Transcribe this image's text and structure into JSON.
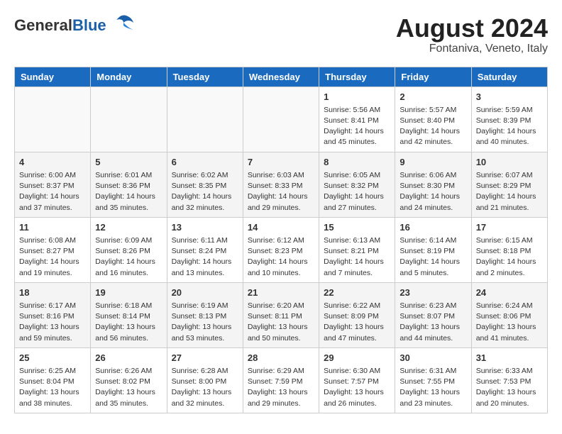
{
  "header": {
    "logo_general": "General",
    "logo_blue": "Blue",
    "month": "August 2024",
    "location": "Fontaniva, Veneto, Italy"
  },
  "days_of_week": [
    "Sunday",
    "Monday",
    "Tuesday",
    "Wednesday",
    "Thursday",
    "Friday",
    "Saturday"
  ],
  "weeks": [
    [
      {
        "day": "",
        "info": ""
      },
      {
        "day": "",
        "info": ""
      },
      {
        "day": "",
        "info": ""
      },
      {
        "day": "",
        "info": ""
      },
      {
        "day": "1",
        "info": "Sunrise: 5:56 AM\nSunset: 8:41 PM\nDaylight: 14 hours\nand 45 minutes."
      },
      {
        "day": "2",
        "info": "Sunrise: 5:57 AM\nSunset: 8:40 PM\nDaylight: 14 hours\nand 42 minutes."
      },
      {
        "day": "3",
        "info": "Sunrise: 5:59 AM\nSunset: 8:39 PM\nDaylight: 14 hours\nand 40 minutes."
      }
    ],
    [
      {
        "day": "4",
        "info": "Sunrise: 6:00 AM\nSunset: 8:37 PM\nDaylight: 14 hours\nand 37 minutes."
      },
      {
        "day": "5",
        "info": "Sunrise: 6:01 AM\nSunset: 8:36 PM\nDaylight: 14 hours\nand 35 minutes."
      },
      {
        "day": "6",
        "info": "Sunrise: 6:02 AM\nSunset: 8:35 PM\nDaylight: 14 hours\nand 32 minutes."
      },
      {
        "day": "7",
        "info": "Sunrise: 6:03 AM\nSunset: 8:33 PM\nDaylight: 14 hours\nand 29 minutes."
      },
      {
        "day": "8",
        "info": "Sunrise: 6:05 AM\nSunset: 8:32 PM\nDaylight: 14 hours\nand 27 minutes."
      },
      {
        "day": "9",
        "info": "Sunrise: 6:06 AM\nSunset: 8:30 PM\nDaylight: 14 hours\nand 24 minutes."
      },
      {
        "day": "10",
        "info": "Sunrise: 6:07 AM\nSunset: 8:29 PM\nDaylight: 14 hours\nand 21 minutes."
      }
    ],
    [
      {
        "day": "11",
        "info": "Sunrise: 6:08 AM\nSunset: 8:27 PM\nDaylight: 14 hours\nand 19 minutes."
      },
      {
        "day": "12",
        "info": "Sunrise: 6:09 AM\nSunset: 8:26 PM\nDaylight: 14 hours\nand 16 minutes."
      },
      {
        "day": "13",
        "info": "Sunrise: 6:11 AM\nSunset: 8:24 PM\nDaylight: 14 hours\nand 13 minutes."
      },
      {
        "day": "14",
        "info": "Sunrise: 6:12 AM\nSunset: 8:23 PM\nDaylight: 14 hours\nand 10 minutes."
      },
      {
        "day": "15",
        "info": "Sunrise: 6:13 AM\nSunset: 8:21 PM\nDaylight: 14 hours\nand 7 minutes."
      },
      {
        "day": "16",
        "info": "Sunrise: 6:14 AM\nSunset: 8:19 PM\nDaylight: 14 hours\nand 5 minutes."
      },
      {
        "day": "17",
        "info": "Sunrise: 6:15 AM\nSunset: 8:18 PM\nDaylight: 14 hours\nand 2 minutes."
      }
    ],
    [
      {
        "day": "18",
        "info": "Sunrise: 6:17 AM\nSunset: 8:16 PM\nDaylight: 13 hours\nand 59 minutes."
      },
      {
        "day": "19",
        "info": "Sunrise: 6:18 AM\nSunset: 8:14 PM\nDaylight: 13 hours\nand 56 minutes."
      },
      {
        "day": "20",
        "info": "Sunrise: 6:19 AM\nSunset: 8:13 PM\nDaylight: 13 hours\nand 53 minutes."
      },
      {
        "day": "21",
        "info": "Sunrise: 6:20 AM\nSunset: 8:11 PM\nDaylight: 13 hours\nand 50 minutes."
      },
      {
        "day": "22",
        "info": "Sunrise: 6:22 AM\nSunset: 8:09 PM\nDaylight: 13 hours\nand 47 minutes."
      },
      {
        "day": "23",
        "info": "Sunrise: 6:23 AM\nSunset: 8:07 PM\nDaylight: 13 hours\nand 44 minutes."
      },
      {
        "day": "24",
        "info": "Sunrise: 6:24 AM\nSunset: 8:06 PM\nDaylight: 13 hours\nand 41 minutes."
      }
    ],
    [
      {
        "day": "25",
        "info": "Sunrise: 6:25 AM\nSunset: 8:04 PM\nDaylight: 13 hours\nand 38 minutes."
      },
      {
        "day": "26",
        "info": "Sunrise: 6:26 AM\nSunset: 8:02 PM\nDaylight: 13 hours\nand 35 minutes."
      },
      {
        "day": "27",
        "info": "Sunrise: 6:28 AM\nSunset: 8:00 PM\nDaylight: 13 hours\nand 32 minutes."
      },
      {
        "day": "28",
        "info": "Sunrise: 6:29 AM\nSunset: 7:59 PM\nDaylight: 13 hours\nand 29 minutes."
      },
      {
        "day": "29",
        "info": "Sunrise: 6:30 AM\nSunset: 7:57 PM\nDaylight: 13 hours\nand 26 minutes."
      },
      {
        "day": "30",
        "info": "Sunrise: 6:31 AM\nSunset: 7:55 PM\nDaylight: 13 hours\nand 23 minutes."
      },
      {
        "day": "31",
        "info": "Sunrise: 6:33 AM\nSunset: 7:53 PM\nDaylight: 13 hours\nand 20 minutes."
      }
    ]
  ],
  "empty_first_row_count": 4
}
